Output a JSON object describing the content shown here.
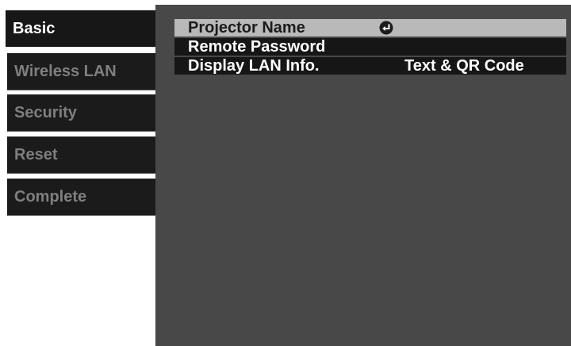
{
  "sidebar": {
    "items": [
      {
        "label": "Basic",
        "active": true
      },
      {
        "label": "Wireless LAN",
        "active": false
      },
      {
        "label": "Security",
        "active": false
      },
      {
        "label": "Reset",
        "active": false
      },
      {
        "label": "Complete",
        "active": false
      }
    ]
  },
  "menu": {
    "rows": [
      {
        "label": "Projector Name",
        "icon": "enter-icon",
        "selected": true
      },
      {
        "label": "Remote Password"
      },
      {
        "label": "Display LAN Info.",
        "value": "Text & QR Code"
      }
    ]
  },
  "colors": {
    "panel": "#484848",
    "row": "#161616",
    "selected_row": "#b9b9b9",
    "tab": "#1b1b1b",
    "inactive_text": "#7f7f7f"
  }
}
